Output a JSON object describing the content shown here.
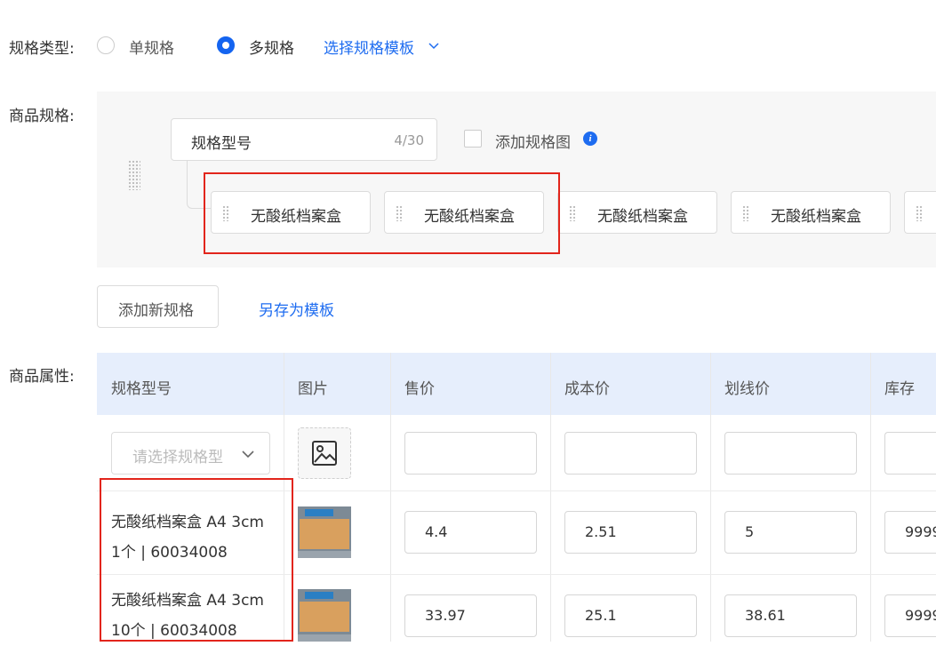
{
  "spec_type": {
    "label": "规格类型:",
    "options": [
      {
        "label": "单规格",
        "selected": false
      },
      {
        "label": "多规格",
        "selected": true
      }
    ],
    "template_link": "选择规格模板"
  },
  "product_spec": {
    "label": "商品规格:",
    "spec_name": "规格型号",
    "char_count": "4/30",
    "add_image_label": "添加规格图",
    "values": [
      "无酸纸档案盒",
      "无酸纸档案盒",
      "无酸纸档案盒",
      "无酸纸档案盒"
    ],
    "add_new_button": "添加新规格",
    "save_template_link": "另存为模板"
  },
  "attributes": {
    "label": "商品属性:",
    "columns": [
      "规格型号",
      "图片",
      "售价",
      "成本价",
      "划线价",
      "库存"
    ],
    "select_placeholder": "请选择规格型",
    "rows": [
      {
        "name_line1": "无酸纸档案盒 A4 3cm",
        "name_line2": "1个 | 60034008",
        "price": "4.4",
        "cost": "2.51",
        "strike": "5",
        "stock": "9999"
      },
      {
        "name_line1": "无酸纸档案盒 A4 3cm",
        "name_line2": "10个 | 60034008",
        "price": "33.97",
        "cost": "25.1",
        "strike": "38.61",
        "stock": "9999"
      }
    ]
  },
  "colors": {
    "accent": "#1e6cf0",
    "highlight": "#e2251c",
    "header_bg": "#e6eefc"
  }
}
